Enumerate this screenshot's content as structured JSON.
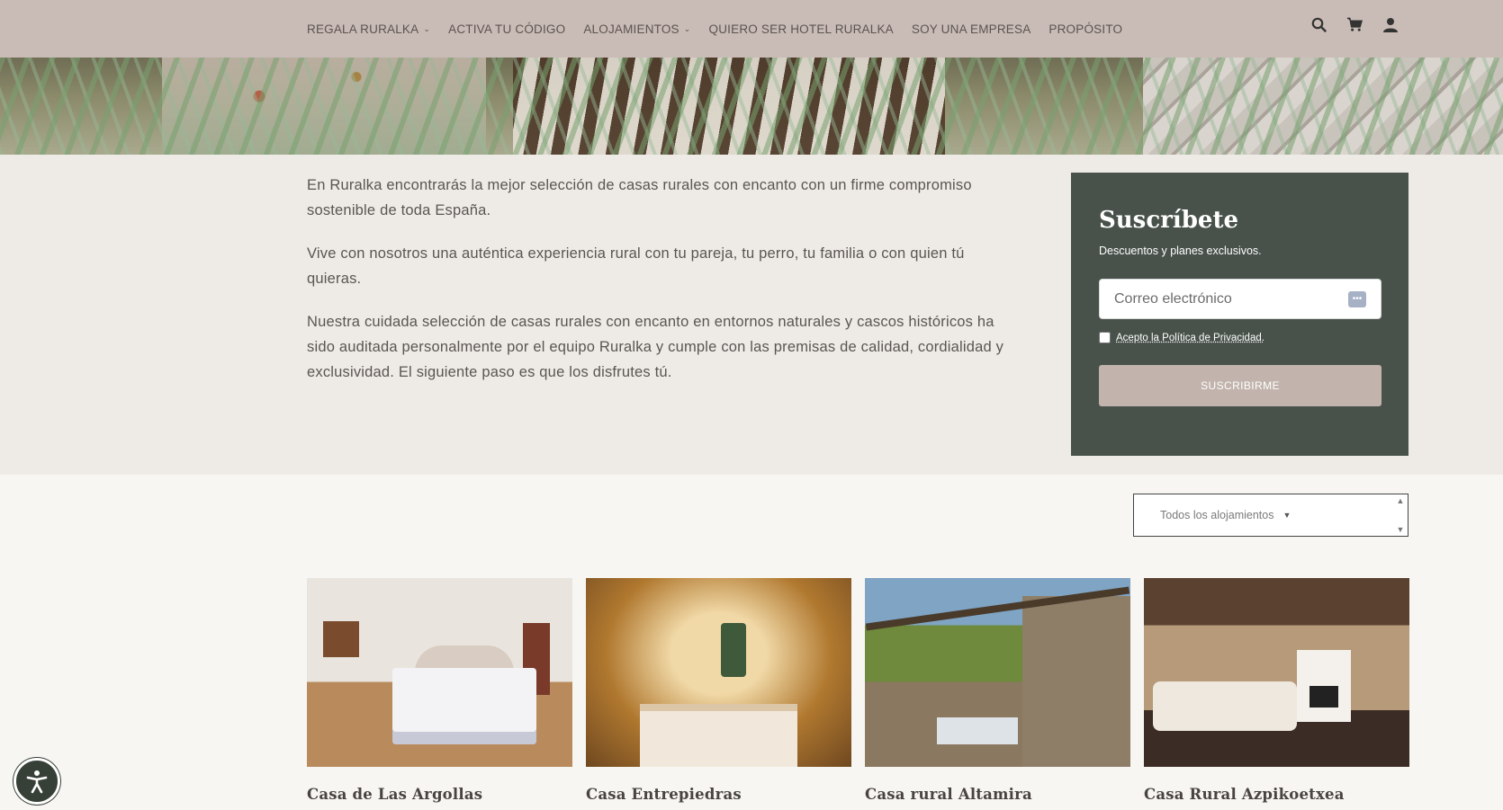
{
  "nav": {
    "items": [
      {
        "label": "REGALA RURALKA",
        "dropdown": true
      },
      {
        "label": "ACTIVA TU CÓDIGO",
        "dropdown": false
      },
      {
        "label": "ALOJAMIENTOS",
        "dropdown": true
      },
      {
        "label": "QUIERO SER HOTEL RURALKA",
        "dropdown": false
      },
      {
        "label": "SOY UNA EMPRESA",
        "dropdown": false
      },
      {
        "label": "PROPÓSITO",
        "dropdown": false
      }
    ],
    "icons": [
      "search-icon",
      "cart-icon",
      "user-icon"
    ]
  },
  "intro": {
    "paragraphs": [
      "En Ruralka encontrarás la mejor selección de casas rurales con encanto con un firme compromiso sostenible de toda España.",
      "Vive con nosotros una auténtica experiencia rural con tu pareja, tu perro, tu familia o con quien tú quieras.",
      "Nuestra cuidada selección de casas rurales con encanto en entornos naturales y cascos históricos ha sido auditada personalmente por el equipo Ruralka y cumple con las premisas de calidad, cordialidad y exclusividad. El siguiente paso es que los disfrutes tú."
    ]
  },
  "subscribe": {
    "title": "Suscríbete",
    "subtitle": "Descuentos y planes exclusivos.",
    "email_placeholder": "Correo electrónico",
    "privacy_label": "Acepto la Política de Privacidad.",
    "button_label": "SUSCRIBIRME",
    "colors": {
      "panel": "#48524a",
      "button": "#c2b3ad"
    }
  },
  "filter": {
    "selected": "Todos los alojamientos"
  },
  "listings": [
    {
      "title": "Casa de Las Argollas"
    },
    {
      "title": "Casa Entrepiedras"
    },
    {
      "title": "Casa rural Altamira"
    },
    {
      "title": "Casa Rural Azpikoetxea"
    }
  ],
  "colors": {
    "nav_bg": "#c9bcb6",
    "intro_bg": "#eeebe6",
    "page_bg": "#f7f6f3",
    "accessibility_button": "#374037"
  }
}
